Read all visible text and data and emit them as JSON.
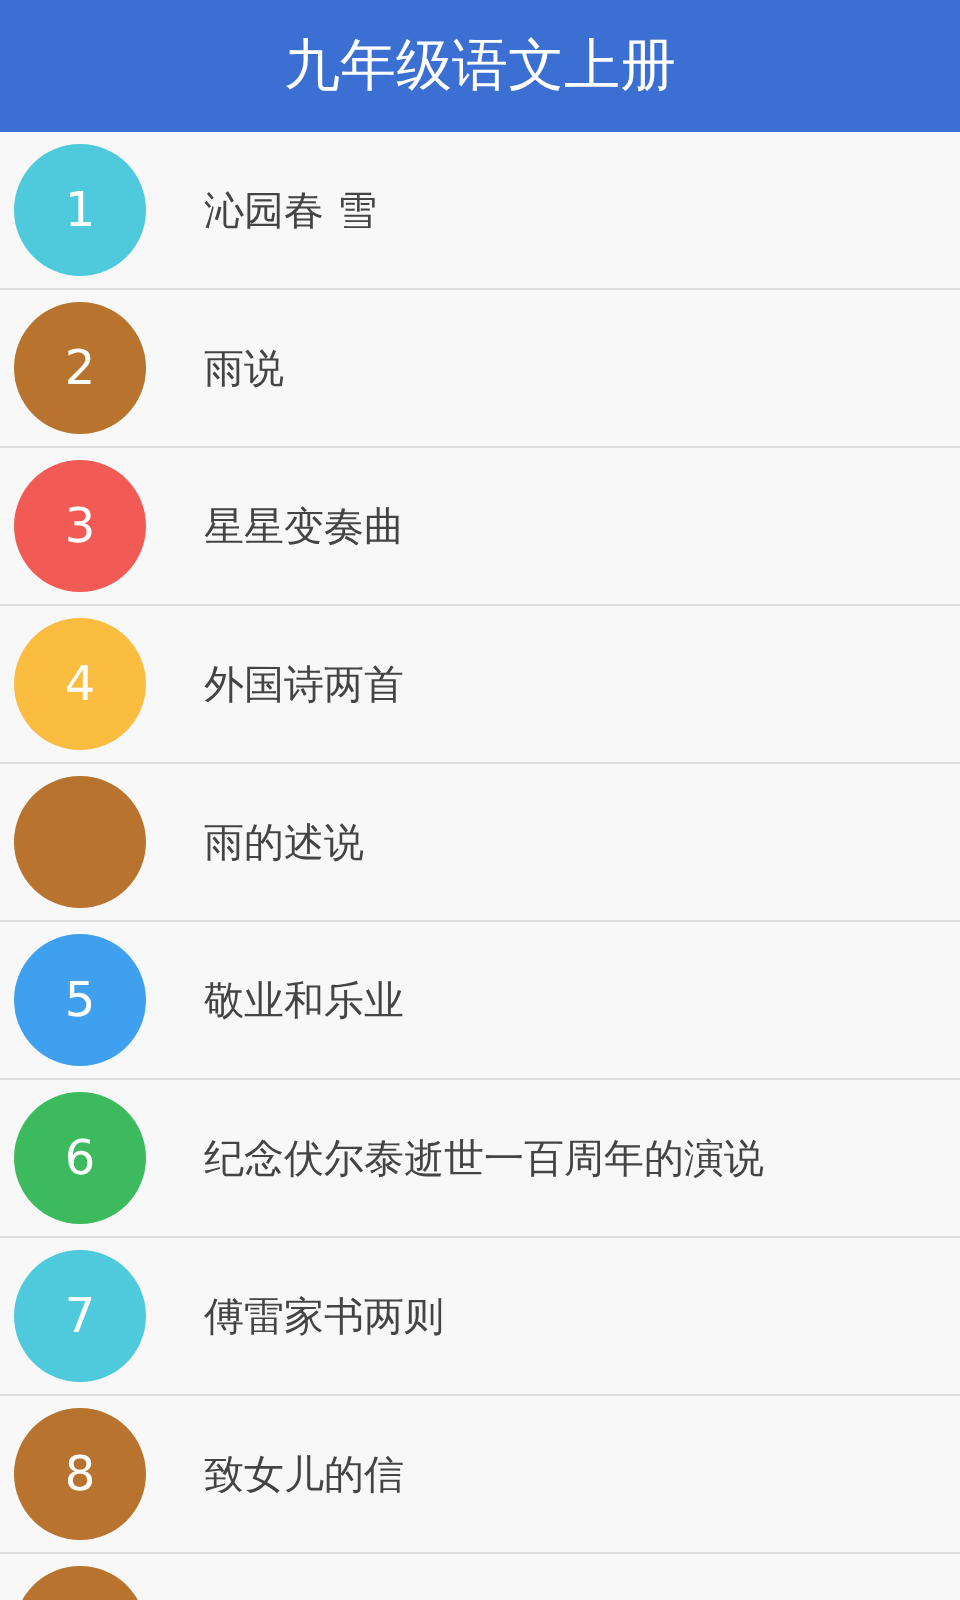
{
  "header": {
    "title": "九年级语文上册"
  },
  "lessons": [
    {
      "number": "1",
      "title": "沁园春 雪",
      "color": "#4fc9dc"
    },
    {
      "number": "2",
      "title": "雨说",
      "color": "#b8732e"
    },
    {
      "number": "3",
      "title": "星星变奏曲",
      "color": "#f25b55"
    },
    {
      "number": "4",
      "title": "外国诗两首",
      "color": "#fbbd3f"
    },
    {
      "title": "雨的述说",
      "color": "#b8732e"
    },
    {
      "number": "5",
      "title": "敬业和乐业",
      "color": "#3fa0f0"
    },
    {
      "number": "6",
      "title": "纪念伏尔泰逝世一百周年的演说",
      "color": "#3dba5e"
    },
    {
      "number": "7",
      "title": "傅雷家书两则",
      "color": "#4fc9dc"
    },
    {
      "number": "8",
      "title": "致女儿的信",
      "color": "#b8732e"
    },
    {
      "color": "#b8732e"
    }
  ]
}
